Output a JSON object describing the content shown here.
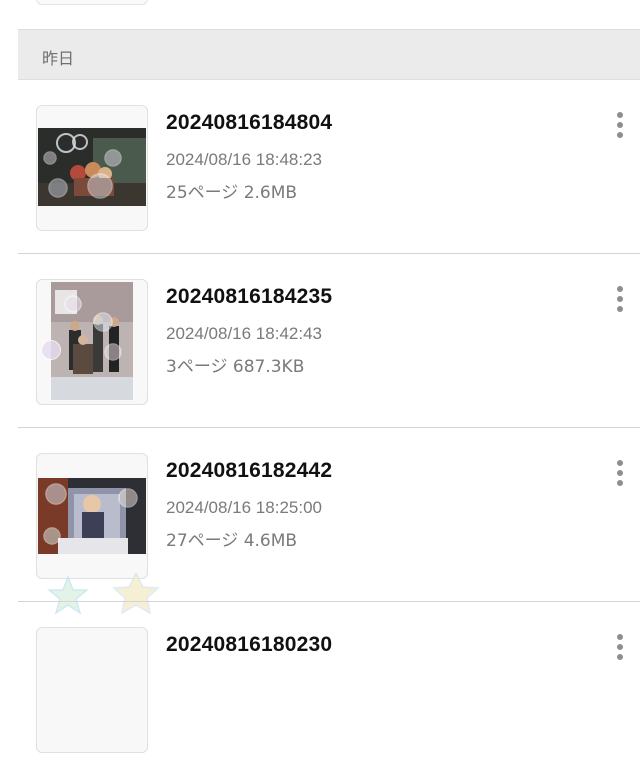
{
  "section": {
    "label": "昨日"
  },
  "items": [
    {
      "title": "20240816184804",
      "datetime": "2024/08/16 18:48:23",
      "meta": "25ページ 2.6MB"
    },
    {
      "title": "20240816184235",
      "datetime": "2024/08/16 18:42:43",
      "meta": "3ページ 687.3KB"
    },
    {
      "title": "20240816182442",
      "datetime": "2024/08/16 18:25:00",
      "meta": "27ページ 4.6MB"
    },
    {
      "title": "20240816180230"
    }
  ],
  "icons": {
    "more": "more-vertical-icon"
  },
  "colors": {
    "header_bg": "#ebebeb",
    "title": "#111111",
    "secondary_text": "#7a7a7a",
    "divider": "#d4d4d4"
  }
}
